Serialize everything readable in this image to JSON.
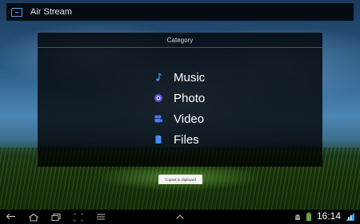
{
  "app": {
    "title": "Air Stream"
  },
  "dialog": {
    "title": "Category",
    "items": [
      {
        "label": "Music",
        "icon": "music-note-icon",
        "color": "#3a8cff"
      },
      {
        "label": "Photo",
        "icon": "photo-icon",
        "color": "#7a6cff"
      },
      {
        "label": "Video",
        "icon": "video-icon",
        "color": "#4a7bff"
      },
      {
        "label": "Files",
        "icon": "file-icon",
        "color": "#3f8cff"
      }
    ]
  },
  "toast": {
    "text": "Copied to clipboard"
  },
  "system_bar": {
    "time": "16:14",
    "nav_icons": [
      "back-icon",
      "home-icon",
      "recent-apps-icon",
      "screenshot-icon",
      "menu-icon",
      "chevron-up-icon"
    ],
    "status_icons": [
      "android-debug-icon",
      "battery-icon",
      "wifi-icon"
    ]
  },
  "colors": {
    "accent": "#4aa3ff"
  }
}
